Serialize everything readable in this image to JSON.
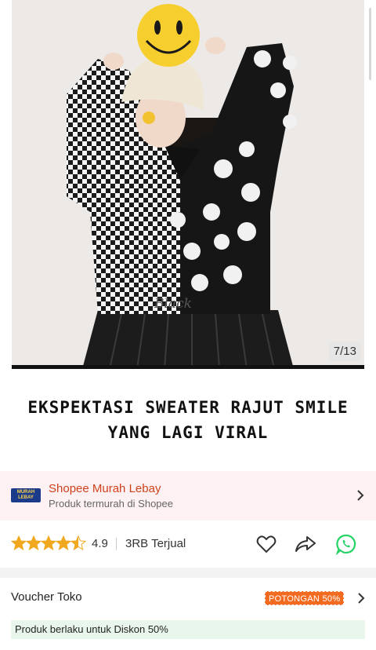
{
  "gallery": {
    "counter": "7/13",
    "sweater_text": "Black"
  },
  "caption": {
    "line1": "EKSPEKTASI SWEATER RAJUT SMILE",
    "line2": "YANG LAGI VIRAL"
  },
  "shop": {
    "logo_line1": "MURAH",
    "logo_line2": "LEBAY",
    "name": "Shopee Murah Lebay",
    "subtitle": "Produk termurah di Shopee"
  },
  "rating": {
    "stars": 4.5,
    "value": "4.9",
    "sold": "3RB Terjual"
  },
  "voucher": {
    "title": "Voucher Toko",
    "badge": "POTONGAN 50%",
    "note": "Produk berlaku untuk Diskon 50%"
  },
  "colors": {
    "star": "#f0a81e",
    "shop_name": "#d0421c",
    "badge": "#f36b21",
    "whatsapp": "#25d366"
  },
  "icons": {
    "wishlist": "heart-icon",
    "share": "share-icon",
    "whatsapp": "whatsapp-icon",
    "chevron": "chevron-right-icon"
  }
}
